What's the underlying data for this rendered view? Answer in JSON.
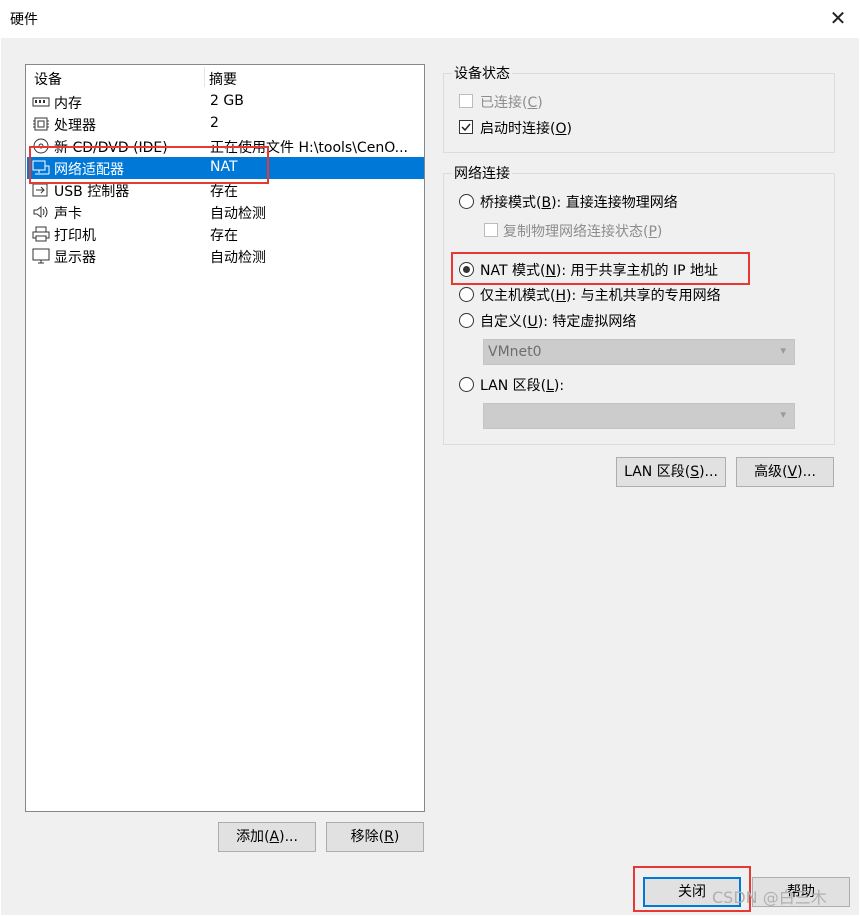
{
  "window": {
    "title": "硬件",
    "close_glyph": "✕"
  },
  "device_list": {
    "columns": [
      "设备",
      "摘要"
    ],
    "rows": [
      {
        "icon": "memory-icon",
        "name": "内存",
        "summary": "2 GB"
      },
      {
        "icon": "processor-icon",
        "name": "处理器",
        "summary": "2"
      },
      {
        "icon": "cd-dvd-icon",
        "name": "新 CD/DVD (IDE)",
        "summary": "正在使用文件 H:\\tools\\CenO..."
      },
      {
        "icon": "network-adapter-icon",
        "name": "网络适配器",
        "summary": "NAT",
        "selected": true
      },
      {
        "icon": "usb-icon",
        "name": "USB 控制器",
        "summary": "存在"
      },
      {
        "icon": "sound-icon",
        "name": "声卡",
        "summary": "自动检测"
      },
      {
        "icon": "printer-icon",
        "name": "打印机",
        "summary": "存在"
      },
      {
        "icon": "display-icon",
        "name": "显示器",
        "summary": "自动检测"
      }
    ]
  },
  "buttons": {
    "add": {
      "label": "添加",
      "mn": "A",
      "rest": "..."
    },
    "remove": {
      "label": "移除",
      "mn": "R",
      "rest": ""
    },
    "lan_segments": {
      "label": "LAN 区段",
      "mn": "S",
      "rest": "..."
    },
    "advanced": {
      "label": "高级",
      "mn": "V",
      "rest": "..."
    },
    "close": "关闭",
    "help": "帮助"
  },
  "device_status": {
    "title": "设备状态",
    "connected": {
      "label": "已连接",
      "mn": "C",
      "checked": false,
      "disabled": true
    },
    "connect_at_power_on": {
      "label": "启动时连接",
      "mn": "O",
      "checked": true
    }
  },
  "network_connection": {
    "title": "网络连接",
    "bridged": {
      "label": "桥接模式",
      "mn": "B",
      "desc": ": 直接连接物理网络"
    },
    "replicate": {
      "label": "复制物理网络连接状态",
      "mn": "P",
      "disabled": true
    },
    "nat": {
      "label": "NAT 模式",
      "mn": "N",
      "desc": ": 用于共享主机的 IP 地址",
      "selected": true
    },
    "host_only": {
      "label": "仅主机模式",
      "mn": "H",
      "desc": ": 与主机共享的专用网络"
    },
    "custom": {
      "label": "自定义",
      "mn": "U",
      "desc": ": 特定虚拟网络"
    },
    "custom_select": "VMnet0",
    "lan_segment": {
      "label": "LAN 区段",
      "mn": "L",
      "desc": ":"
    },
    "lan_select": ""
  },
  "watermark": "CSDN @白三木",
  "colors": {
    "selection": "#0078d7",
    "highlight_box": "#e53935"
  }
}
